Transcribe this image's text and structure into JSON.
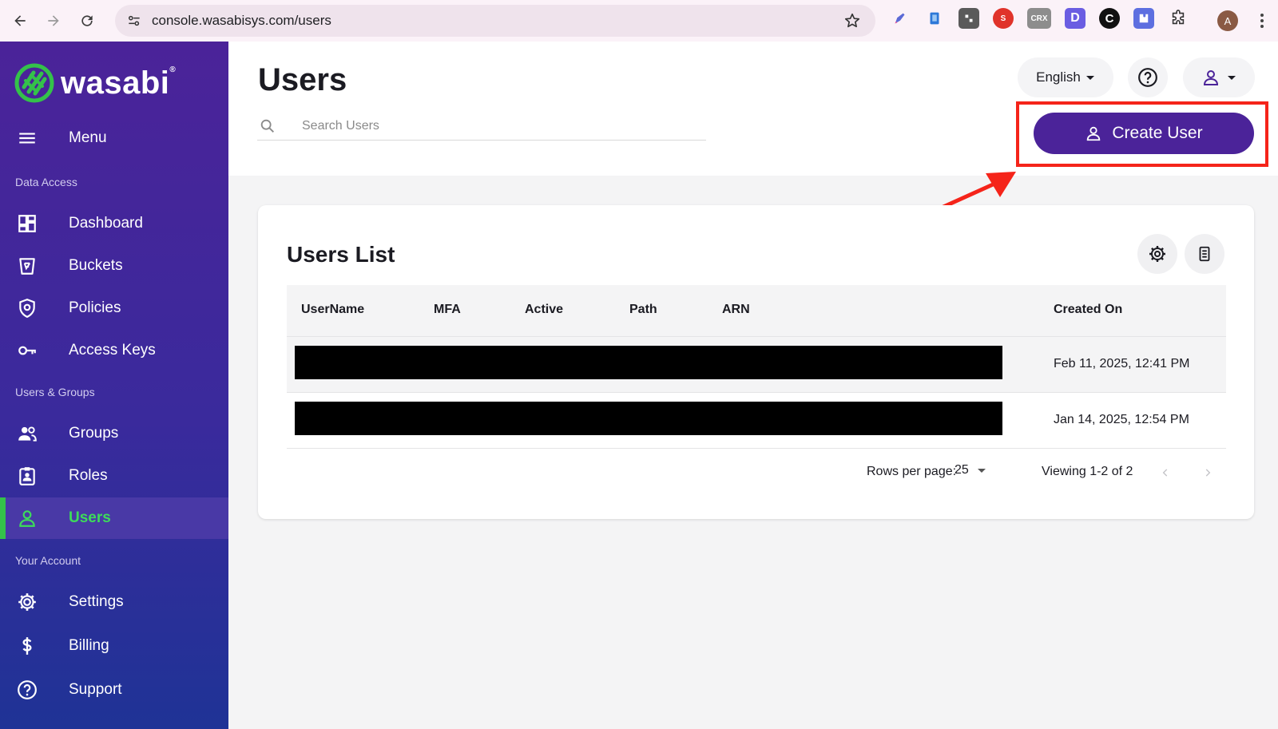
{
  "browser": {
    "url": "console.wasabisys.com/users",
    "profile_initial": "A",
    "ext_crx": "CRX",
    "ext_d": "D",
    "ext_c": "C"
  },
  "sidebar": {
    "logo_text": "wasabi",
    "menu_label": "Menu",
    "sections": {
      "data_access": "Data Access",
      "users_groups": "Users & Groups",
      "your_account": "Your Account"
    },
    "items": [
      {
        "label": "Dashboard",
        "icon": "dashboard-icon"
      },
      {
        "label": "Buckets",
        "icon": "bucket-icon"
      },
      {
        "label": "Policies",
        "icon": "shield-icon"
      },
      {
        "label": "Access Keys",
        "icon": "key-icon"
      },
      {
        "label": "Groups",
        "icon": "group-icon"
      },
      {
        "label": "Roles",
        "icon": "badge-icon"
      },
      {
        "label": "Users",
        "icon": "user-icon",
        "active": true
      },
      {
        "label": "Settings",
        "icon": "gear-icon"
      },
      {
        "label": "Billing",
        "icon": "dollar-icon"
      },
      {
        "label": "Support",
        "icon": "help-icon"
      }
    ]
  },
  "header": {
    "title": "Users",
    "search_placeholder": "Search Users",
    "language": "English",
    "create_label": "Create User"
  },
  "users_list": {
    "title": "Users List",
    "columns": [
      "UserName",
      "MFA",
      "Active",
      "Path",
      "ARN",
      "Created On"
    ],
    "rows": [
      {
        "created_on": "Feb 11, 2025, 12:41 PM"
      },
      {
        "created_on": "Jan 14, 2025, 12:54 PM"
      }
    ],
    "rows_per_page_label": "Rows per page:",
    "rows_per_page_value": "25",
    "viewing": "Viewing 1-2 of 2"
  },
  "colors": {
    "brand_purple": "#4b2399",
    "active_green": "#34c24a",
    "annotation_red": "#f5241a"
  }
}
